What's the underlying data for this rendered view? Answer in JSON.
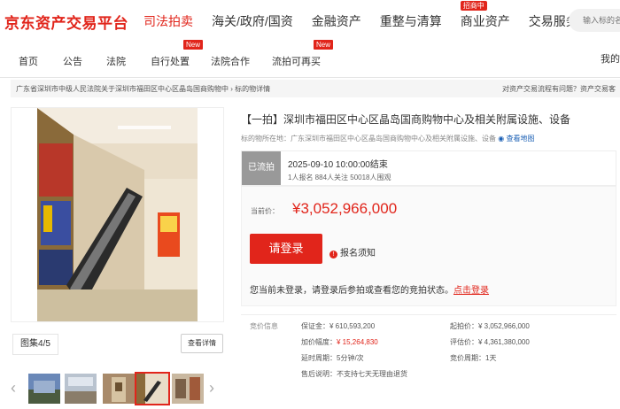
{
  "header": {
    "logo": "京东资产交易平台",
    "nav": [
      {
        "label": "司法拍卖",
        "active": true
      },
      {
        "label": "海关/政府/国资"
      },
      {
        "label": "金融资产"
      },
      {
        "label": "重整与清算"
      },
      {
        "label": "商业资产",
        "badge": "招商中"
      },
      {
        "label": "交易服务"
      }
    ],
    "search_placeholder": "输入标的名称"
  },
  "subnav": {
    "items": [
      "首页",
      "公告",
      "法院",
      "自行处置",
      "法院合作",
      "流拍可再买"
    ],
    "new_badge": "New",
    "my": "我的"
  },
  "breadcrumb": {
    "left": "广东省深圳市中级人民法院关于深圳市福田区中心区晶岛国商购物中 › 标的物详情",
    "right": "对资产交易流程有问题？资产交易客"
  },
  "gallery": {
    "counter": "图集4/5",
    "detail_button": "查看详情"
  },
  "lot": {
    "title": "【一拍】深圳市福田区中心区晶岛国商购物中心及相关附属设施、设备",
    "location_label": "标的物所在地：",
    "location": "广东深圳市福田区中心区晶岛国商购物中心及相关附属设施、设备",
    "map_link": "查看地图",
    "status": "已流拍",
    "end_time": "2025-09-10 10:00:00结束",
    "stats": "1人报名   884人关注   50018人围观",
    "price_label": "当前价：",
    "price": "¥3,052,966,000",
    "login_button": "请登录",
    "notice_icon": "!",
    "notice": "报名须知",
    "login_tip": "您当前未登录，请登录后参拍或查看您的竞拍状态。",
    "login_link": "点击登录"
  },
  "info": {
    "head": "竞价信息",
    "deposit": "保证金：¥ 610,593,200",
    "start_price": "起拍价：¥ 3,052,966,000",
    "increment_label": "加价幅度：",
    "increment": "¥ 15,264,830",
    "appraisal": "评估价：¥ 4,361,380,000",
    "delay": "延时周期：5分钟/次",
    "period": "竞价周期：1天",
    "after_sale": "售后说明：不支持七天无理由退货"
  },
  "colors": {
    "brand_red": "#e1251b",
    "status_gray": "#999999",
    "link_blue": "#1a5fb4"
  }
}
